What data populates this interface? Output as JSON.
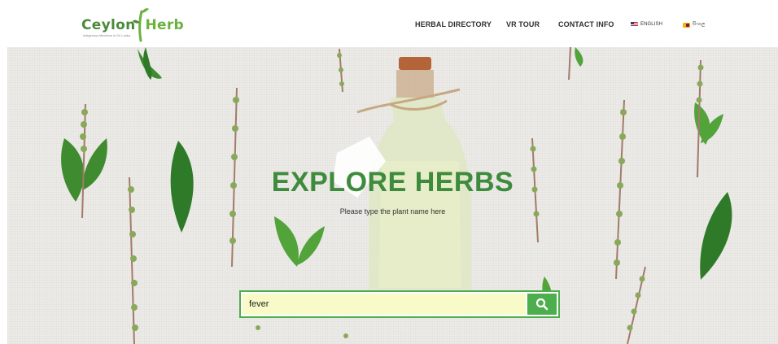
{
  "brand": {
    "name_part1": "Ceylon",
    "name_part2": "Herb",
    "tagline": "Indigenous Medicine in Sri Lanka",
    "accent": "#4cae4c",
    "title_color": "#3f8b3d"
  },
  "nav": {
    "items": [
      {
        "label": "HERBAL DIRECTORY"
      },
      {
        "label": "VR TOUR"
      },
      {
        "label": "CONTACT INFO"
      }
    ],
    "languages": [
      {
        "label": "ENGLISH",
        "icon": "us-flag-icon"
      },
      {
        "label": "සිංහල",
        "icon": "sri-lanka-flag-icon"
      }
    ]
  },
  "hero": {
    "title": "EXPLORE HERBS",
    "subtitle": "Please type the plant name here"
  },
  "search": {
    "value": "fever",
    "button_icon": "search-icon"
  }
}
